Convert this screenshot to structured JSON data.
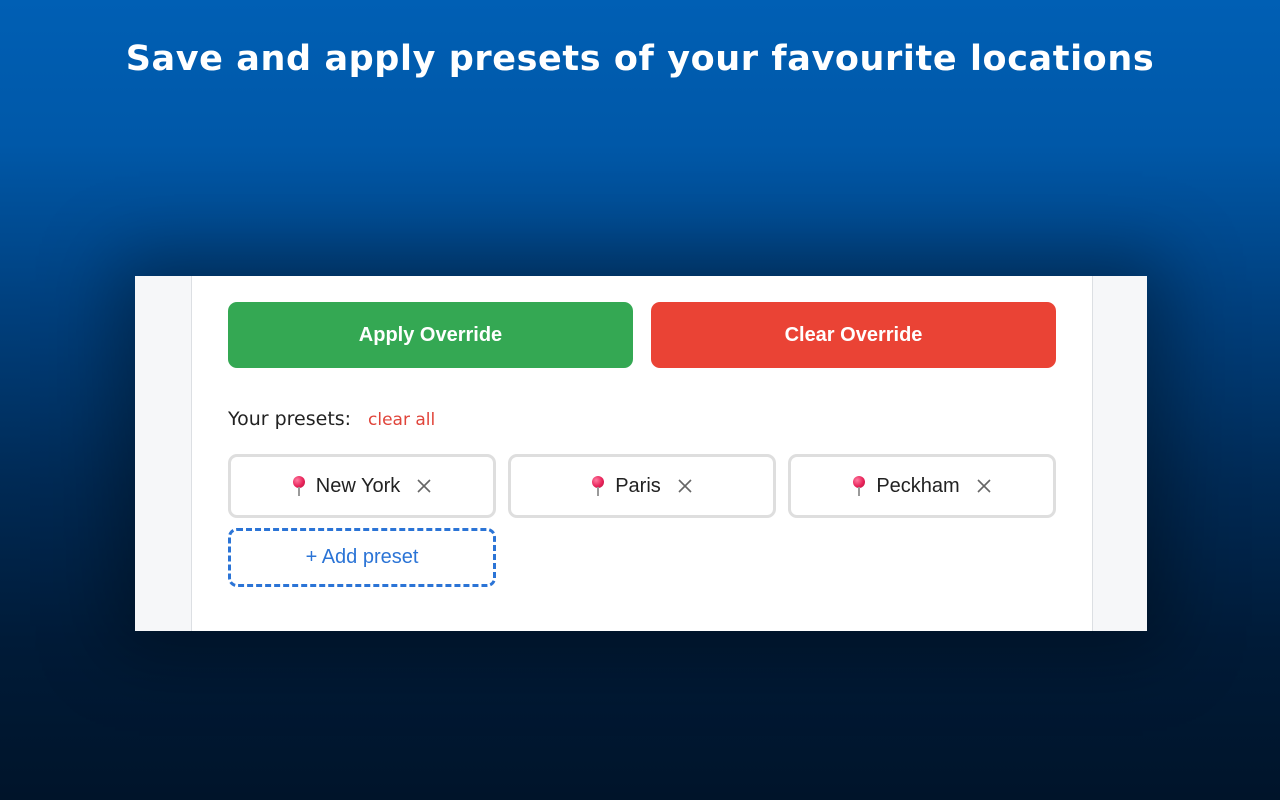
{
  "headline": "Save and apply presets of your favourite locations",
  "actions": {
    "apply_label": "Apply Override",
    "clear_label": "Clear Override"
  },
  "presets": {
    "label": "Your presets:",
    "clear_all_label": "clear all",
    "items": [
      {
        "label": "New York",
        "icon": "pushpin-icon",
        "remove_icon": "close-icon"
      },
      {
        "label": "Paris",
        "icon": "pushpin-icon",
        "remove_icon": "close-icon"
      },
      {
        "label": "Peckham",
        "icon": "pushpin-icon",
        "remove_icon": "close-icon"
      }
    ],
    "add_label": "+ Add preset"
  },
  "colors": {
    "apply": "#34a853",
    "clear": "#ea4335",
    "link_red": "#e0443a",
    "accent_blue": "#2b74d6",
    "background_top": "#005fb4",
    "background_bottom": "#00142a"
  }
}
